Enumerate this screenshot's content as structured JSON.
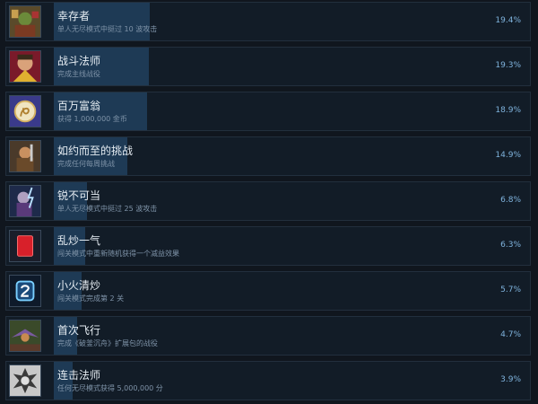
{
  "achievements": [
    {
      "icon": "orc-warrior-icon",
      "name": "幸存者",
      "desc": "单人无尽模式中挺过 10 波攻击",
      "pct": "19.4%",
      "value": 19.4
    },
    {
      "icon": "battle-mage-portrait-icon",
      "name": "战斗法师",
      "desc": "完成主线战役",
      "pct": "19.3%",
      "value": 19.3
    },
    {
      "icon": "gold-coin-icon",
      "name": "百万富翁",
      "desc": "获得 1,000,000 金币",
      "pct": "18.9%",
      "value": 18.9
    },
    {
      "icon": "challenge-warrior-icon",
      "name": "如约而至的挑战",
      "desc": "完成任何每周挑战",
      "pct": "14.9%",
      "value": 14.9
    },
    {
      "icon": "lightning-mage-icon",
      "name": "锐不可当",
      "desc": "单人无尽模式中挺过 25 波攻击",
      "pct": "6.8%",
      "value": 6.8
    },
    {
      "icon": "red-card-icon",
      "name": "乱炒一气",
      "desc": "闯关模式中重新随机获得一个减益效果",
      "pct": "6.3%",
      "value": 6.3
    },
    {
      "icon": "number-two-card-icon",
      "name": "小火清炒",
      "desc": "闯关模式完成第 2 关",
      "pct": "5.7%",
      "value": 5.7
    },
    {
      "icon": "flying-creature-icon",
      "name": "首次飞行",
      "desc": "完成《破釜沉舟》扩展包的战役",
      "pct": "4.7%",
      "value": 4.7
    },
    {
      "icon": "explosion-badge-icon",
      "name": "连击法师",
      "desc": "任何无尽模式获得 5,000,000 分",
      "pct": "3.9%",
      "value": 3.9
    }
  ]
}
